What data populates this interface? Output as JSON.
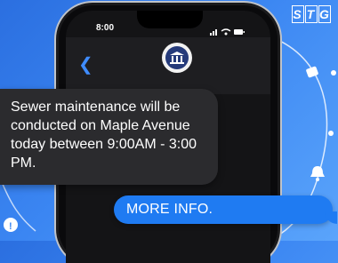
{
  "status_bar": {
    "time": "8:00"
  },
  "brand_logo": [
    "S",
    "T",
    "G"
  ],
  "messages": {
    "incoming": "Sewer maintenance will be conducted on Maple Avenue today between 9:00AM - 3:00 PM.",
    "outgoing": "MORE INFO."
  },
  "colors": {
    "background": "#3b86f2",
    "incoming_bubble": "#2b2b2e",
    "outgoing_bubble": "#1f7bf2",
    "accent": "#3f8cff"
  },
  "icons": [
    "back-chevron-icon",
    "government-building-icon",
    "signal-icon",
    "wifi-icon",
    "battery-icon",
    "bell-icon",
    "info-icon"
  ]
}
